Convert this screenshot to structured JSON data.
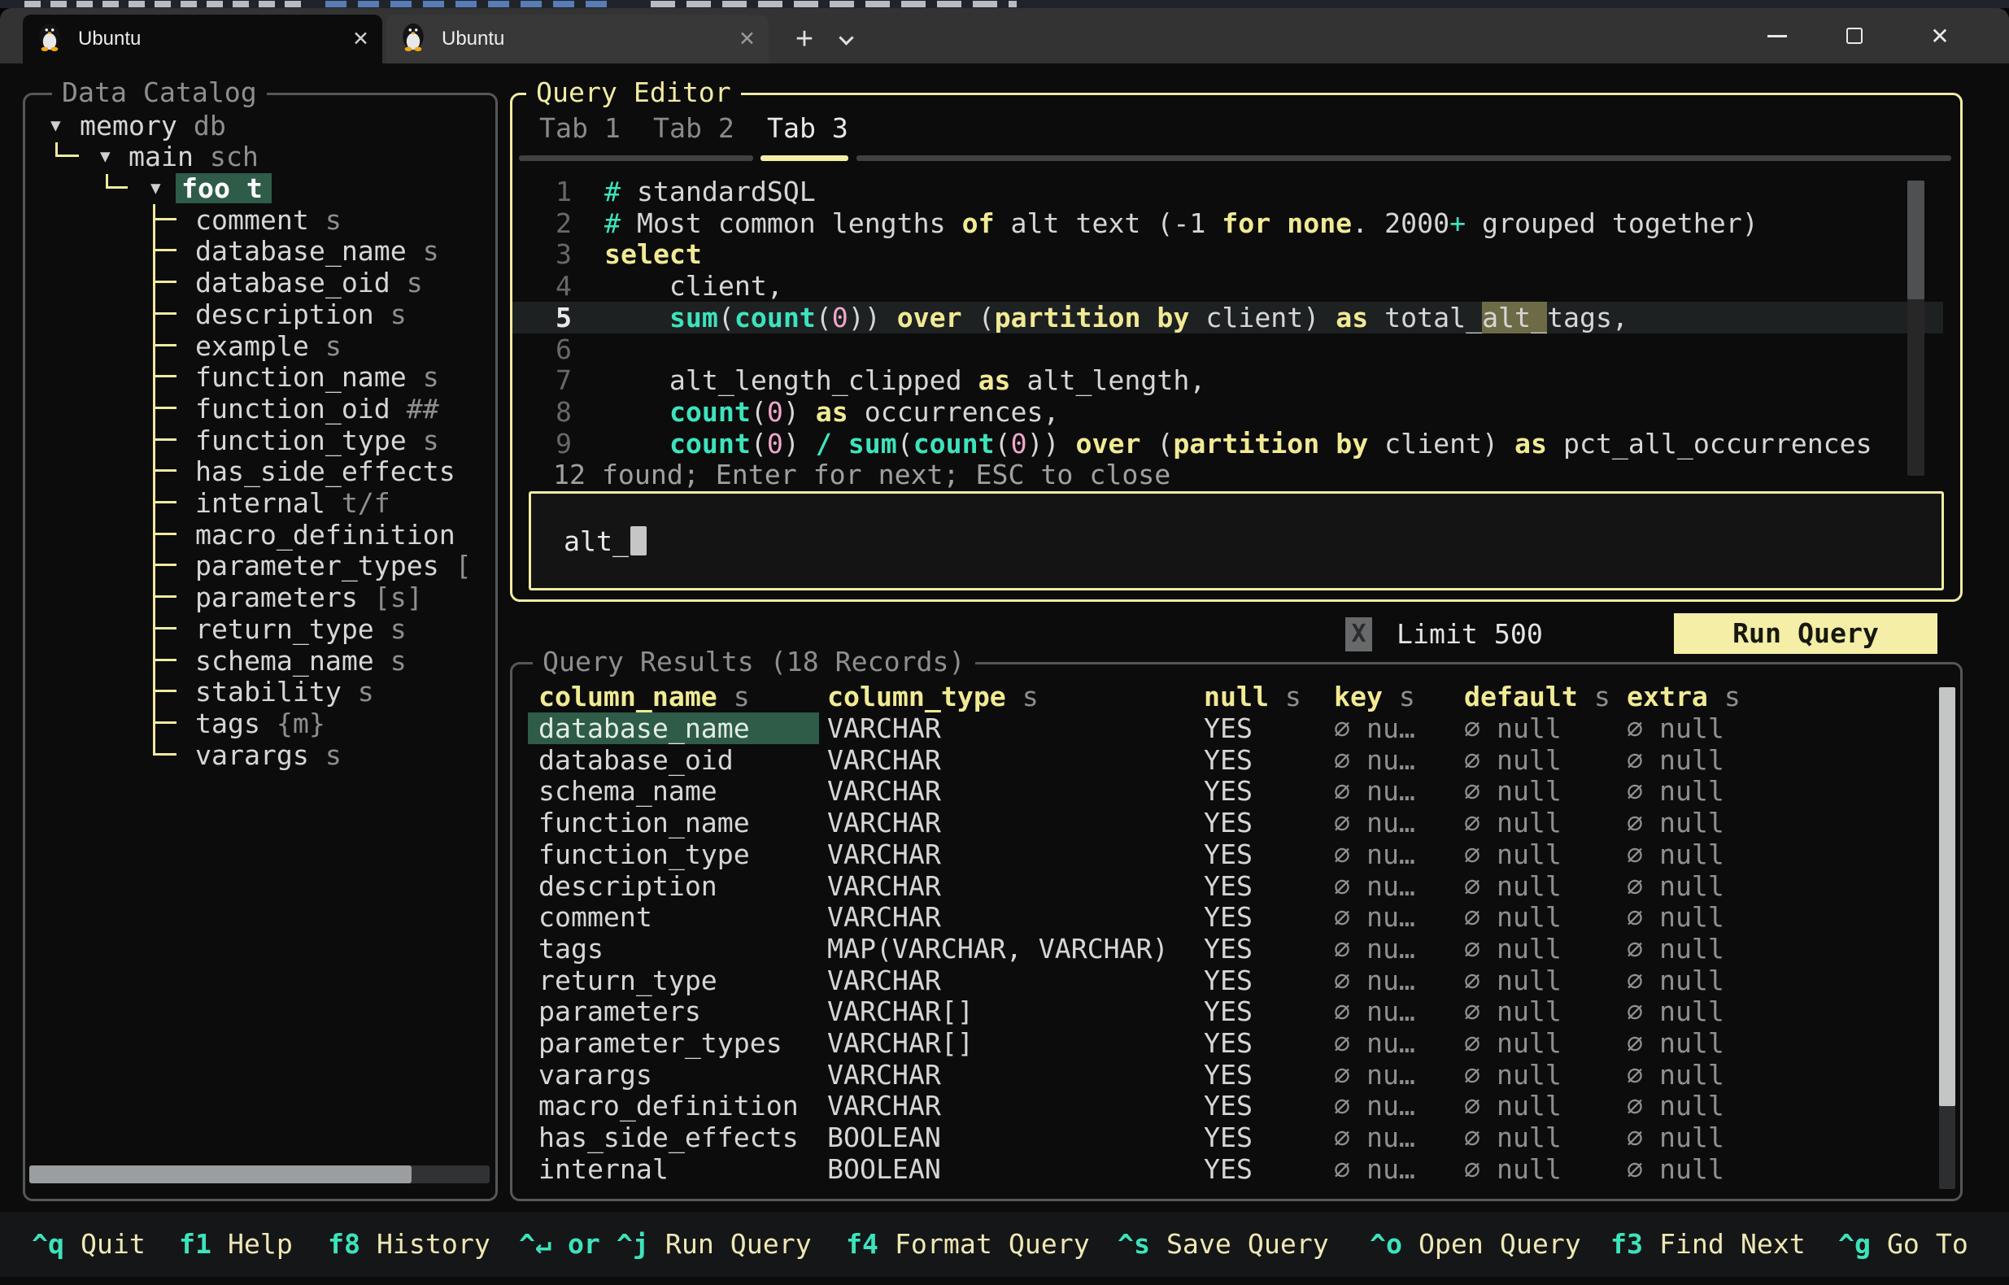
{
  "window": {
    "tabs": [
      {
        "title": "Ubuntu",
        "active": true
      },
      {
        "title": "Ubuntu",
        "active": false
      }
    ],
    "new_tab_label": "+"
  },
  "colors": {
    "accent_yellow": "#f1eba3",
    "teal": "#3de3bc",
    "pink": "#f0a6ca",
    "selection_green": "#2e5c49",
    "match_olive": "#6d6b46",
    "run_button_bg": "#f4eea6",
    "terminal_bg": "#0c0c0c"
  },
  "catalog": {
    "title": "Data Catalog",
    "root": {
      "name": "memory",
      "type": "db"
    },
    "schema": {
      "name": "main",
      "type": "sch"
    },
    "table": {
      "name": "foo",
      "type": "t",
      "selected": true
    },
    "columns": [
      {
        "name": "comment",
        "type": "s"
      },
      {
        "name": "database_name",
        "type": "s"
      },
      {
        "name": "database_oid",
        "type": "s"
      },
      {
        "name": "description",
        "type": "s"
      },
      {
        "name": "example",
        "type": "s"
      },
      {
        "name": "function_name",
        "type": "s"
      },
      {
        "name": "function_oid",
        "type": "##"
      },
      {
        "name": "function_type",
        "type": "s"
      },
      {
        "name": "has_side_effects",
        "type": ""
      },
      {
        "name": "internal",
        "type": "t/f"
      },
      {
        "name": "macro_definition",
        "type": ""
      },
      {
        "name": "parameter_types",
        "type": "["
      },
      {
        "name": "parameters",
        "type": "[s]"
      },
      {
        "name": "return_type",
        "type": "s"
      },
      {
        "name": "schema_name",
        "type": "s"
      },
      {
        "name": "stability",
        "type": "s"
      },
      {
        "name": "tags",
        "type": "{m}"
      },
      {
        "name": "varargs",
        "type": "s"
      }
    ]
  },
  "editor": {
    "title": "Query Editor",
    "tabs": [
      {
        "label": "Tab 1",
        "active": false
      },
      {
        "label": "Tab 2",
        "active": false
      },
      {
        "label": "Tab 3",
        "active": true
      }
    ],
    "lines": [
      {
        "num": "1",
        "segs": [
          {
            "t": "# ",
            "c": "op"
          },
          {
            "t": "standardSQL",
            "c": "p"
          }
        ]
      },
      {
        "num": "2",
        "segs": [
          {
            "t": "# ",
            "c": "op"
          },
          {
            "t": "Most common lengths ",
            "c": "p"
          },
          {
            "t": "of",
            "c": "kw"
          },
          {
            "t": " alt text (-1 ",
            "c": "p"
          },
          {
            "t": "for",
            "c": "kw"
          },
          {
            "t": " ",
            "c": "p"
          },
          {
            "t": "none",
            "c": "kw"
          },
          {
            "t": ". 2000",
            "c": "p"
          },
          {
            "t": "+",
            "c": "op"
          },
          {
            "t": " grouped together)",
            "c": "p"
          }
        ]
      },
      {
        "num": "3",
        "segs": [
          {
            "t": "select",
            "c": "kw"
          }
        ]
      },
      {
        "num": "4",
        "segs": [
          {
            "t": "    client,",
            "c": "p"
          }
        ]
      },
      {
        "num": "5",
        "active": true,
        "segs": [
          {
            "t": "    ",
            "c": "p"
          },
          {
            "t": "sum",
            "c": "fn"
          },
          {
            "t": "(",
            "c": "p"
          },
          {
            "t": "count",
            "c": "fn"
          },
          {
            "t": "(",
            "c": "p"
          },
          {
            "t": "0",
            "c": "num"
          },
          {
            "t": ")) ",
            "c": "p"
          },
          {
            "t": "over",
            "c": "kw"
          },
          {
            "t": " (",
            "c": "p"
          },
          {
            "t": "partition",
            "c": "kw"
          },
          {
            "t": " ",
            "c": "p"
          },
          {
            "t": "by",
            "c": "kw"
          },
          {
            "t": " client) ",
            "c": "p"
          },
          {
            "t": "as",
            "c": "kw"
          },
          {
            "t": " total_",
            "c": "p"
          },
          {
            "t": "alt_",
            "c": "match"
          },
          {
            "t": "tags,",
            "c": "p"
          }
        ]
      },
      {
        "num": "6",
        "segs": []
      },
      {
        "num": "7",
        "segs": [
          {
            "t": "    alt_length_clipped ",
            "c": "p"
          },
          {
            "t": "as",
            "c": "kw"
          },
          {
            "t": " alt_length,",
            "c": "p"
          }
        ]
      },
      {
        "num": "8",
        "segs": [
          {
            "t": "    ",
            "c": "p"
          },
          {
            "t": "count",
            "c": "fn"
          },
          {
            "t": "(",
            "c": "p"
          },
          {
            "t": "0",
            "c": "num"
          },
          {
            "t": ") ",
            "c": "p"
          },
          {
            "t": "as",
            "c": "kw"
          },
          {
            "t": " occurrences,",
            "c": "p"
          }
        ]
      },
      {
        "num": "9",
        "segs": [
          {
            "t": "    ",
            "c": "p"
          },
          {
            "t": "count",
            "c": "fn"
          },
          {
            "t": "(",
            "c": "p"
          },
          {
            "t": "0",
            "c": "num"
          },
          {
            "t": ") ",
            "c": "p"
          },
          {
            "t": "/",
            "c": "fn"
          },
          {
            "t": " ",
            "c": "p"
          },
          {
            "t": "sum",
            "c": "fn"
          },
          {
            "t": "(",
            "c": "p"
          },
          {
            "t": "count",
            "c": "fn"
          },
          {
            "t": "(",
            "c": "p"
          },
          {
            "t": "0",
            "c": "num"
          },
          {
            "t": ")) ",
            "c": "p"
          },
          {
            "t": "over",
            "c": "kw"
          },
          {
            "t": " (",
            "c": "p"
          },
          {
            "t": "partition",
            "c": "kw"
          },
          {
            "t": " ",
            "c": "p"
          },
          {
            "t": "by",
            "c": "kw"
          },
          {
            "t": " client) ",
            "c": "p"
          },
          {
            "t": "as",
            "c": "kw"
          },
          {
            "t": " pct_all_occurrences",
            "c": "p"
          }
        ]
      }
    ],
    "search_status": "12 found; Enter for next; ESC to close",
    "search_value": "alt_",
    "limit_checkbox": "X",
    "limit_label": "Limit 500",
    "run_label": "Run Query"
  },
  "results": {
    "title": "Query Results (18 Records)",
    "headers": [
      {
        "label": "column_name",
        "type": "s"
      },
      {
        "label": "column_type",
        "type": "s"
      },
      {
        "label": "null",
        "type": "s"
      },
      {
        "label": "key",
        "type": "s"
      },
      {
        "label": "default",
        "type": "s"
      },
      {
        "label": "extra",
        "type": "s"
      }
    ],
    "rows": [
      {
        "cells": [
          "database_name",
          "VARCHAR",
          "YES",
          "∅ nu…",
          "∅ null",
          "∅ null"
        ],
        "selected_cell": 0
      },
      {
        "cells": [
          "database_oid",
          "VARCHAR",
          "YES",
          "∅ nu…",
          "∅ null",
          "∅ null"
        ]
      },
      {
        "cells": [
          "schema_name",
          "VARCHAR",
          "YES",
          "∅ nu…",
          "∅ null",
          "∅ null"
        ]
      },
      {
        "cells": [
          "function_name",
          "VARCHAR",
          "YES",
          "∅ nu…",
          "∅ null",
          "∅ null"
        ]
      },
      {
        "cells": [
          "function_type",
          "VARCHAR",
          "YES",
          "∅ nu…",
          "∅ null",
          "∅ null"
        ]
      },
      {
        "cells": [
          "description",
          "VARCHAR",
          "YES",
          "∅ nu…",
          "∅ null",
          "∅ null"
        ]
      },
      {
        "cells": [
          "comment",
          "VARCHAR",
          "YES",
          "∅ nu…",
          "∅ null",
          "∅ null"
        ]
      },
      {
        "cells": [
          "tags",
          "MAP(VARCHAR, VARCHAR)",
          "YES",
          "∅ nu…",
          "∅ null",
          "∅ null"
        ]
      },
      {
        "cells": [
          "return_type",
          "VARCHAR",
          "YES",
          "∅ nu…",
          "∅ null",
          "∅ null"
        ]
      },
      {
        "cells": [
          "parameters",
          "VARCHAR[]",
          "YES",
          "∅ nu…",
          "∅ null",
          "∅ null"
        ]
      },
      {
        "cells": [
          "parameter_types",
          "VARCHAR[]",
          "YES",
          "∅ nu…",
          "∅ null",
          "∅ null"
        ]
      },
      {
        "cells": [
          "varargs",
          "VARCHAR",
          "YES",
          "∅ nu…",
          "∅ null",
          "∅ null"
        ]
      },
      {
        "cells": [
          "macro_definition",
          "VARCHAR",
          "YES",
          "∅ nu…",
          "∅ null",
          "∅ null"
        ]
      },
      {
        "cells": [
          "has_side_effects",
          "BOOLEAN",
          "YES",
          "∅ nu…",
          "∅ null",
          "∅ null"
        ]
      },
      {
        "cells": [
          "internal",
          "BOOLEAN",
          "YES",
          "∅ nu…",
          "∅ null",
          "∅ null"
        ]
      }
    ]
  },
  "footer": {
    "items": [
      {
        "segs": [
          {
            "t": "^q",
            "c": "k"
          },
          {
            "t": " Quit",
            "c": "l"
          }
        ]
      },
      {
        "segs": [
          {
            "t": "f1",
            "c": "k"
          },
          {
            "t": " Help",
            "c": "l"
          }
        ]
      },
      {
        "segs": [
          {
            "t": "f8",
            "c": "k"
          },
          {
            "t": " History",
            "c": "l"
          }
        ]
      },
      {
        "segs": [
          {
            "t": "^↵ ",
            "c": "k"
          },
          {
            "t": "or",
            "c": "k"
          },
          {
            "t": " ^j",
            "c": "k"
          },
          {
            "t": " Run Query",
            "c": "l"
          }
        ]
      },
      {
        "segs": [
          {
            "t": "f4",
            "c": "k"
          },
          {
            "t": " Format Query",
            "c": "l"
          }
        ]
      },
      {
        "segs": [
          {
            "t": "^s",
            "c": "k"
          },
          {
            "t": " Save Query",
            "c": "l"
          }
        ]
      },
      {
        "segs": [
          {
            "t": "^o",
            "c": "k"
          },
          {
            "t": " Open Query",
            "c": "l"
          }
        ]
      },
      {
        "segs": [
          {
            "t": "f3",
            "c": "k"
          },
          {
            "t": " Find Next",
            "c": "l"
          }
        ]
      },
      {
        "segs": [
          {
            "t": "^g",
            "c": "k"
          },
          {
            "t": " Go To",
            "c": "l"
          }
        ]
      }
    ]
  }
}
